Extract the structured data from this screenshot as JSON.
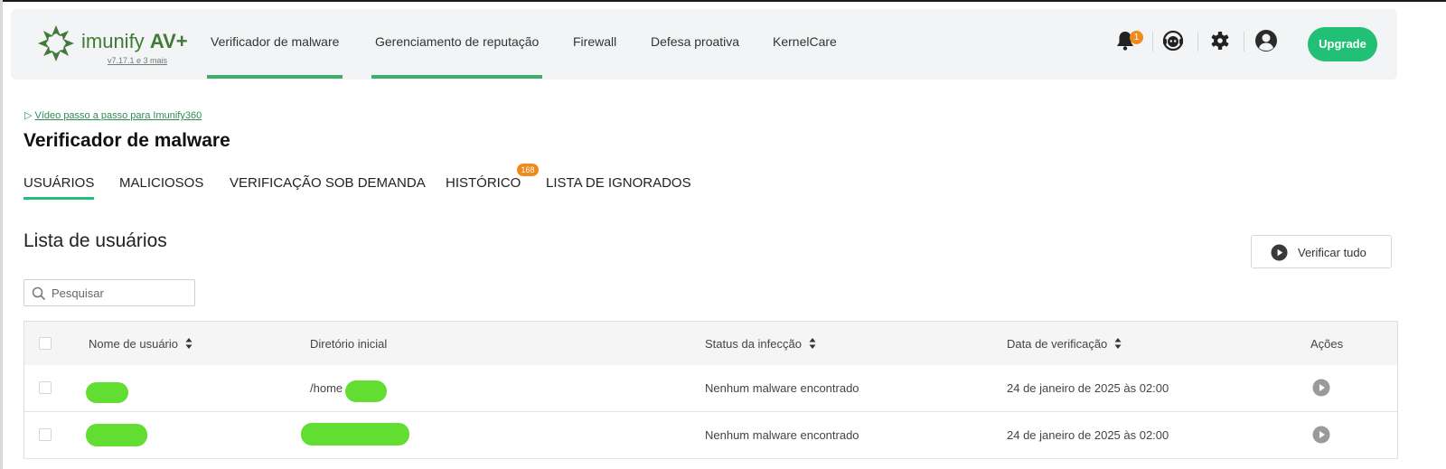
{
  "app": {
    "logo_text": "imunify",
    "logo_suffix": "AV+",
    "version": "v7.17.1 e 3 mais"
  },
  "nav": {
    "items": [
      {
        "label": "Verificador de malware",
        "active": true
      },
      {
        "label": "Gerenciamento de reputação",
        "active": true
      },
      {
        "label": "Firewall",
        "active": false
      },
      {
        "label": "Defesa proativa",
        "active": false
      },
      {
        "label": "KernelCare",
        "active": false
      }
    ],
    "notification_count": "1",
    "icons": [
      "bell-icon",
      "support-icon",
      "gear-icon",
      "user-icon"
    ],
    "upgrade_label": "Upgrade"
  },
  "colors": {
    "accent_green": "#22bf76",
    "nav_underline": "#3fae6a",
    "badge_orange": "#f08a1c",
    "logo_green": "#3f7a36",
    "redaction": "#62dd31"
  },
  "page": {
    "video_link": "Vídeo passo a passo para Imunify360",
    "title": "Verificador de malware"
  },
  "tabs": [
    {
      "label": "USUÁRIOS",
      "active": true
    },
    {
      "label": "MALICIOSOS",
      "active": false
    },
    {
      "label": "VERIFICAÇÃO SOB DEMANDA",
      "active": false
    },
    {
      "label": "HISTÓRICO",
      "active": false,
      "badge": "168"
    },
    {
      "label": "LISTA DE IGNORADOS",
      "active": false
    }
  ],
  "users": {
    "section_title": "Lista de usuários",
    "scan_all_label": "Verificar tudo",
    "search_placeholder": "Pesquisar",
    "columns": [
      "Nome de usuário",
      "Diretório inicial",
      "Status da infecção",
      "Data de verificação",
      "Ações"
    ],
    "rows": [
      {
        "username": "",
        "home_dir": "/home",
        "status": "Nenhum malware encontrado",
        "scan_date": "24 de janeiro de 2025 às 02:00"
      },
      {
        "username": "",
        "home_dir": "",
        "status": "Nenhum malware encontrado",
        "scan_date": "24 de janeiro de 2025 às 02:00"
      }
    ]
  }
}
